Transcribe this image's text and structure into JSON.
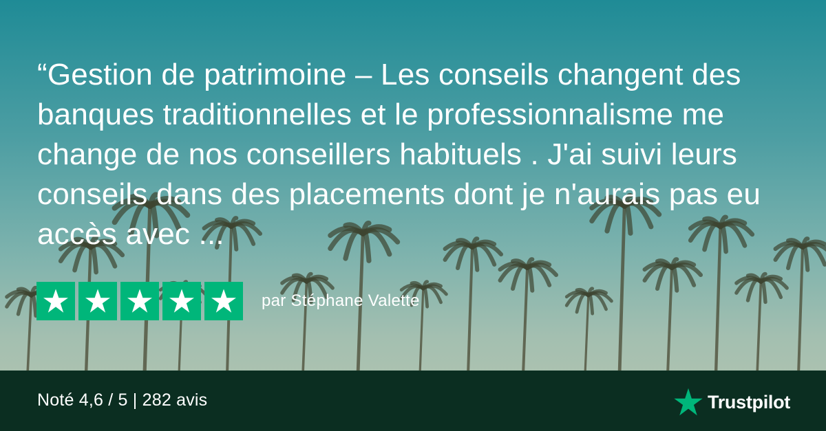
{
  "review": {
    "quote": "“Gestion de patrimoine  –  Les conseils changent des banques traditionnelles et le professionnalisme me change de nos conseillers habituels . J'ai suivi leurs conseils dans des placements dont je n'aurais pas eu accès avec ...",
    "stars": 5,
    "max_stars": 5,
    "author": "par Stéphane Valette",
    "star_color": "#00b67a",
    "star_icon": "star-icon"
  },
  "footer": {
    "score_text": "Noté 4,6 / 5 | 282 avis",
    "brand_name": "Trustpilot",
    "brand_icon": "trustpilot-star-icon",
    "brand_color": "#00b67a",
    "background_color": "#0b2e21"
  },
  "background": {
    "description_icon": "palm-trees-photo"
  }
}
